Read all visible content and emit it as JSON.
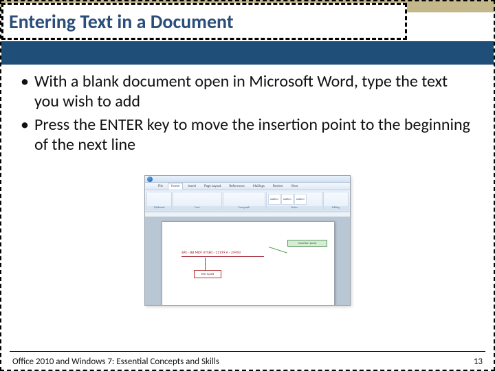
{
  "title": "Entering Text in a Document",
  "bullets": [
    "With a blank document open in Microsoft Word, type the text you wish to add",
    "Press the ENTER key to move the insertion point to the beginning of the next line"
  ],
  "word_shot": {
    "tabs": [
      "File",
      "Home",
      "Insert",
      "Page Layout",
      "References",
      "Mailings",
      "Review",
      "View"
    ],
    "active_tab": "Home",
    "groups": [
      "Clipboard",
      "Font",
      "Paragraph",
      "Styles",
      "Editing"
    ],
    "style_swatches": [
      "AaBbCc",
      "AaBbCc",
      "AaBbCc"
    ],
    "typed_line": "SPE - BB MDF 07580 - 11199 A - 29493",
    "callout_green": "insertion point",
    "callout_red": "text typed"
  },
  "footer": {
    "left": "Office 2010 and Windows 7: Essential Concepts and Skills",
    "right": "13"
  }
}
